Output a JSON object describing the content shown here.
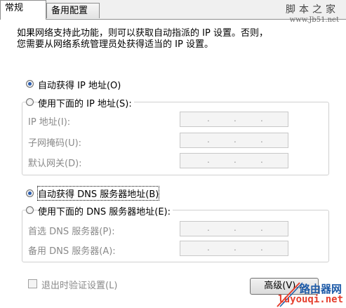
{
  "tabs": [
    {
      "label": "常规"
    },
    {
      "label": "备用配置"
    }
  ],
  "watermark_top": {
    "title": "脚本之家",
    "url": "www.Jb51.net"
  },
  "description": "如果网络支持此功能，则可以获取自动指派的 IP 设置。否则，\n您需要从网络系统管理员处获得适当的 IP 设置。",
  "ip_section": {
    "auto_label": "自动获得 IP 地址(O)",
    "manual_label": "使用下面的 IP 地址(S):",
    "selected": "auto",
    "fields": [
      {
        "label": "IP 地址(I):",
        "value": ". . ."
      },
      {
        "label": "子网掩码(U):",
        "value": ". . ."
      },
      {
        "label": "默认网关(D):",
        "value": ". . ."
      }
    ]
  },
  "dns_section": {
    "auto_label": "自动获得 DNS 服务器地址(B)",
    "manual_label": "使用下面的 DNS 服务器地址(E):",
    "selected": "auto",
    "fields": [
      {
        "label": "首选 DNS 服务器(P):",
        "value": ". . ."
      },
      {
        "label": "备用 DNS 服务器(A):",
        "value": ". . ."
      }
    ]
  },
  "validate_on_exit": {
    "label": "退出时验证设置(L)",
    "checked": false
  },
  "advanced_button": {
    "label": "高级(V)..."
  },
  "watermark_bottom": {
    "title": "路由器网",
    "url": "luyouqi.net"
  },
  "colors": {
    "radio_dot": "#2a5db0",
    "watermark_blue": "#1e5ba8",
    "watermark_red": "#e53f2e"
  }
}
